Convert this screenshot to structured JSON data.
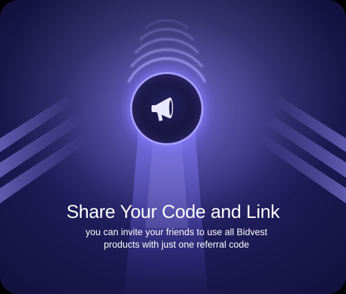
{
  "card": {
    "icon": "megaphone-icon",
    "title": "Share Your Code and Link",
    "description": "you can invite your friends to use all Bidvest products with just one referral code"
  },
  "colors": {
    "background_dark": "#0f0d33",
    "background_mid": "#2b2778",
    "glow": "#a8a0ff",
    "text": "#ffffff"
  }
}
